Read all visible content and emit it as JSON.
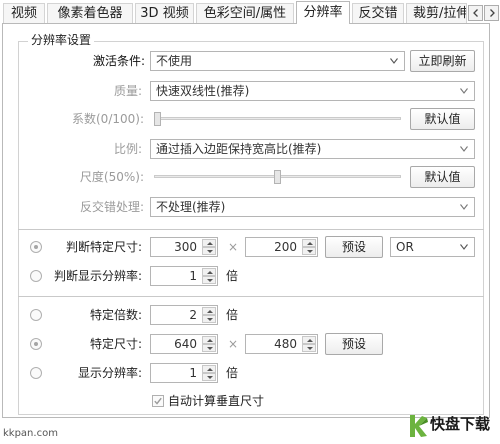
{
  "tabs": [
    {
      "label": "视频",
      "active": false
    },
    {
      "label": "像素着色器",
      "active": false
    },
    {
      "label": "3D 视频",
      "active": false
    },
    {
      "label": "色彩空间/属性",
      "active": false
    },
    {
      "label": "分辨率",
      "active": true
    },
    {
      "label": "反交错",
      "active": false
    },
    {
      "label": "裁剪/拉伸",
      "active": false
    }
  ],
  "tab_scroll": {
    "left_icon": "chevron-left-icon",
    "right_icon": "chevron-right-icon"
  },
  "group": {
    "title": "分辨率设置"
  },
  "activation": {
    "label": "激活条件:",
    "value": "不使用",
    "refresh_label": "立即刷新"
  },
  "quality": {
    "label": "质量:",
    "value": "快速双线性(推荐)"
  },
  "coefficient": {
    "label": "系数(0/100):",
    "value": 0,
    "default_label": "默认值"
  },
  "ratio": {
    "label": "比例:",
    "value": "通过插入边距保持宽高比(推荐)"
  },
  "scale": {
    "label": "尺度(50%):",
    "value": 50,
    "default_label": "默认值"
  },
  "deinterlace": {
    "label": "反交错处理:",
    "value": "不处理(推荐)"
  },
  "detect_size": {
    "label": "判断特定尺寸:",
    "checked": true,
    "width": "300",
    "times": "×",
    "height": "200",
    "preset_label": "预设",
    "logic": "OR"
  },
  "detect_display": {
    "label": "判断显示分辨率:",
    "checked": false,
    "value": "1",
    "unit": "倍"
  },
  "specific_multiple": {
    "label": "特定倍数:",
    "checked": false,
    "value": "2",
    "unit": "倍"
  },
  "specific_size": {
    "label": "特定尺寸:",
    "checked": true,
    "width": "640",
    "times": "×",
    "height": "480",
    "preset_label": "预设"
  },
  "display_resolution": {
    "label": "显示分辨率:",
    "checked": false,
    "value": "1",
    "unit": "倍"
  },
  "auto_vertical": {
    "label": "自动计算垂直尺寸",
    "checked": true
  },
  "watermark": {
    "site": "kkpan.com",
    "brand": "快盘下载"
  },
  "colors": {
    "border": "#b9b9b9",
    "disabled_text": "#9b9b9b",
    "logo_green": "#6cb33f"
  }
}
